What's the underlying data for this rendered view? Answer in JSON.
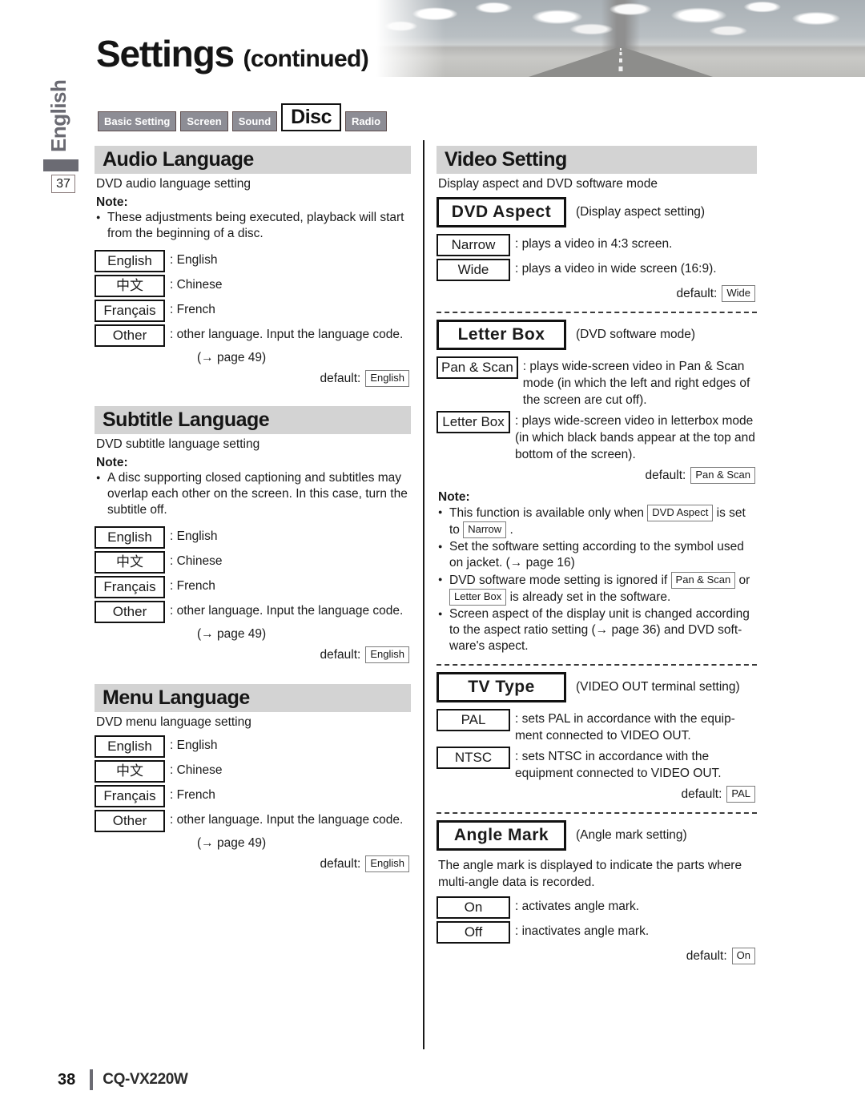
{
  "header": {
    "title": "Settings",
    "title_suffix": "(continued)",
    "photo_alt": "desert-road-photo"
  },
  "side": {
    "language_tab": "English",
    "page_marker": "37"
  },
  "tabs": [
    {
      "label": "Basic Setting",
      "active": false
    },
    {
      "label": "Screen",
      "active": false
    },
    {
      "label": "Sound",
      "active": false
    },
    {
      "label": "Disc",
      "active": true
    },
    {
      "label": "Radio",
      "active": false
    }
  ],
  "left_column": {
    "audio_language": {
      "heading": "Audio Language",
      "subtitle": "DVD audio language setting",
      "note_label": "Note:",
      "notes": [
        "These adjustments being executed, playback will start from the beginning of a disc."
      ],
      "options": [
        {
          "box": "English",
          "desc": ": English"
        },
        {
          "box": "中文",
          "desc": ": Chinese"
        },
        {
          "box": "Français",
          "desc": ": French"
        },
        {
          "box": "Other",
          "desc": ": other language. Input the language code."
        }
      ],
      "page_ref": "(→ page 49)",
      "default_label": "default:",
      "default_value": "English"
    },
    "subtitle_language": {
      "heading": "Subtitle Language",
      "subtitle": "DVD subtitle language setting",
      "note_label": "Note:",
      "notes": [
        "A disc supporting closed captioning and subtitles may overlap each other on the screen. In this case, turn the subtitle off."
      ],
      "options": [
        {
          "box": "English",
          "desc": ": English"
        },
        {
          "box": "中文",
          "desc": ": Chinese"
        },
        {
          "box": "Français",
          "desc": ": French"
        },
        {
          "box": "Other",
          "desc": ": other language. Input the language code."
        }
      ],
      "page_ref": "(→ page 49)",
      "default_label": "default:",
      "default_value": "English"
    },
    "menu_language": {
      "heading": "Menu Language",
      "subtitle": "DVD menu language setting",
      "options": [
        {
          "box": "English",
          "desc": ": English"
        },
        {
          "box": "中文",
          "desc": ": Chinese"
        },
        {
          "box": "Français",
          "desc": ": French"
        },
        {
          "box": "Other",
          "desc": ": other language. Input the language code."
        }
      ],
      "page_ref": "(→ page 49)",
      "default_label": "default:",
      "default_value": "English"
    }
  },
  "right_column": {
    "video_setting": {
      "heading": "Video Setting",
      "subtitle": "Display aspect and DVD software mode"
    },
    "dvd_aspect": {
      "box_title": "DVD Aspect",
      "caption": "(Display aspect setting)",
      "options": [
        {
          "box": "Narrow",
          "desc": ": plays a video in 4:3 screen."
        },
        {
          "box": "Wide",
          "desc": ": plays a video in wide screen (16:9)."
        }
      ],
      "default_label": "default:",
      "default_value": "Wide"
    },
    "letter_box": {
      "box_title": "Letter Box",
      "caption": "(DVD software mode)",
      "options": [
        {
          "box": "Pan & Scan",
          "desc": ": plays wide-screen video in Pan & Scan mode (in which the left and right edges of the screen are cut off)."
        },
        {
          "box": "Letter Box",
          "desc": ": plays wide-screen video in letterbox mode (in which black bands appear at the top and bottom of the screen)."
        }
      ],
      "default_label": "default:",
      "default_value": "Pan & Scan"
    },
    "video_notes": {
      "note_label": "Note:",
      "items": [
        {
          "parts": [
            {
              "t": "text",
              "v": "This function is available only when "
            },
            {
              "t": "box",
              "v": "DVD Aspect"
            },
            {
              "t": "text",
              "v": " is set to "
            },
            {
              "t": "box",
              "v": "Narrow"
            },
            {
              "t": "text",
              "v": " ."
            }
          ]
        },
        {
          "parts": [
            {
              "t": "text",
              "v": "Set the software setting according to the symbol used on jacket. (→ page 16)"
            }
          ]
        },
        {
          "parts": [
            {
              "t": "text",
              "v": "DVD software mode setting is ignored if "
            },
            {
              "t": "box",
              "v": "Pan & Scan"
            },
            {
              "t": "text",
              "v": " or "
            },
            {
              "t": "box",
              "v": "Letter Box"
            },
            {
              "t": "text",
              "v": " is already set in the software."
            }
          ]
        },
        {
          "parts": [
            {
              "t": "text",
              "v": "Screen aspect of the display unit is changed according to the aspect ratio setting (→ page 36) and DVD soft-ware's aspect."
            }
          ]
        }
      ]
    },
    "tv_type": {
      "box_title": "TV Type",
      "caption": "(VIDEO OUT terminal setting)",
      "options": [
        {
          "box": "PAL",
          "desc": ": sets PAL in accordance with the equip-ment connected to VIDEO OUT."
        },
        {
          "box": "NTSC",
          "desc": ": sets NTSC in accordance with the equipment connected to VIDEO OUT."
        }
      ],
      "default_label": "default:",
      "default_value": "PAL"
    },
    "angle_mark": {
      "box_title": "Angle Mark",
      "caption": "(Angle mark setting)",
      "description": "The angle mark is displayed to indicate the parts where multi-angle data is recorded.",
      "options": [
        {
          "box": "On",
          "desc": ": activates angle mark."
        },
        {
          "box": "Off",
          "desc": ": inactivates angle mark."
        }
      ],
      "default_label": "default:",
      "default_value": "On"
    }
  },
  "footer": {
    "page_number": "38",
    "model": "CQ-VX220W"
  }
}
